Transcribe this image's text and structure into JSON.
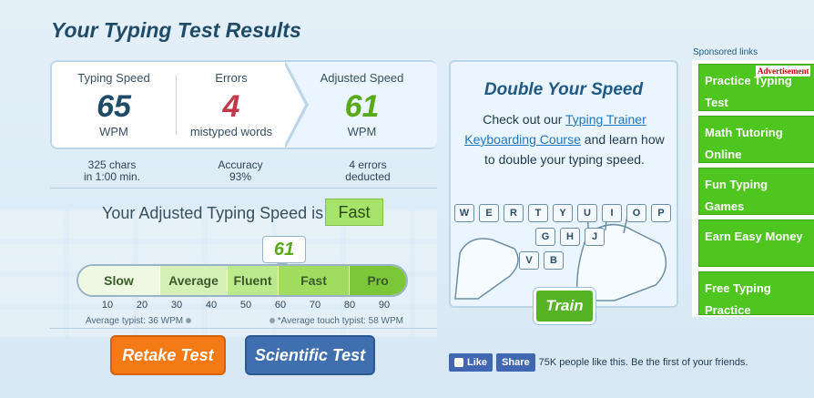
{
  "page": {
    "title": "Your Typing Test Results"
  },
  "stats": {
    "speed": {
      "label": "Typing Speed",
      "value": "65",
      "unit": "WPM",
      "sub1": "325 chars",
      "sub2": "in 1:00 min."
    },
    "errors": {
      "label": "Errors",
      "value": "4",
      "unit": "mistyped words",
      "sub1": "Accuracy",
      "sub2": "93%"
    },
    "adjusted": {
      "label": "Adjusted Speed",
      "value": "61",
      "unit": "WPM",
      "sub1": "4 errors",
      "sub2": "deducted"
    }
  },
  "rating": {
    "text": "Your Adjusted Typing Speed is",
    "badge": "Fast",
    "pointer_value": "61",
    "pointer_wpm": 61
  },
  "speed_bar": {
    "segments": [
      "Slow",
      "Average",
      "Fluent",
      "Fast",
      "Pro"
    ],
    "ticks": [
      "10",
      "20",
      "30",
      "40",
      "50",
      "60",
      "70",
      "80",
      "90"
    ],
    "average_note": "Average typist: 36 WPM",
    "touch_note": "*Average touch typist: 58 WPM"
  },
  "buttons": {
    "retake": "Retake Test",
    "scientific": "Scientific Test",
    "train": "Train"
  },
  "promo": {
    "title": "Double Your Speed",
    "text_before": "Check out our ",
    "link": "Typing Trainer Keyboarding Course",
    "text_after": " and learn how to double your typing speed.",
    "keys_row1": [
      "W",
      "E",
      "R",
      "T",
      "Y",
      "U",
      "I",
      "O",
      "P"
    ],
    "keys_row2": [
      "G",
      "H",
      "J"
    ],
    "keys_row3": [
      "V",
      "B"
    ]
  },
  "social": {
    "like": "Like",
    "share": "Share",
    "text": "75K people like this. Be the first of your friends."
  },
  "sponsored": {
    "label": "Sponsored links",
    "badge": "Advertisement",
    "items": [
      "Practice Typing Test",
      "Math Tutoring Online",
      "Fun Typing Games",
      "Earn Easy Money",
      "Free Typing Practice"
    ]
  },
  "colors": {
    "accent_green": "#5aa91a",
    "error_red": "#c0394b",
    "retake_orange": "#f47a15",
    "scientific_blue": "#3f6fae",
    "ad_green": "#4fc51f"
  }
}
